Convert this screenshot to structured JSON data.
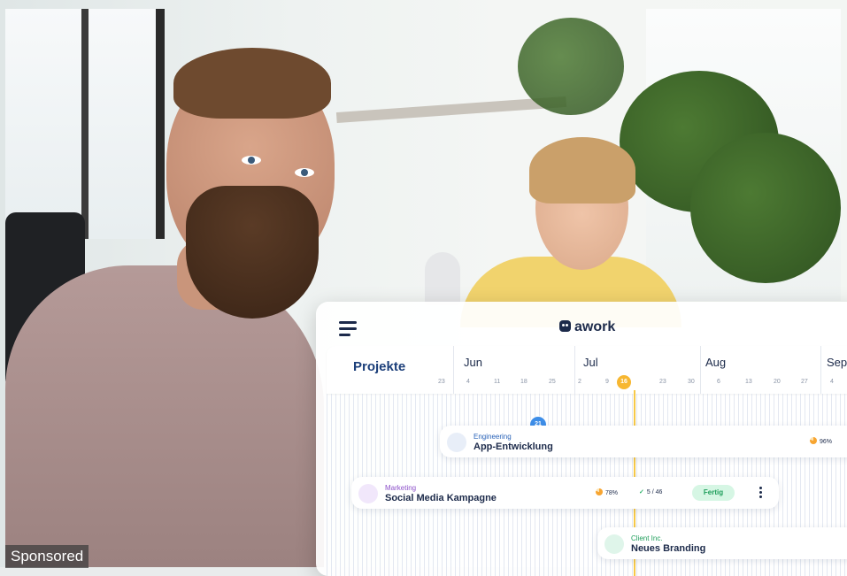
{
  "ad": {
    "label": "Sponsored"
  },
  "app": {
    "brand": "awork",
    "header_label": "Projekte",
    "timeline": {
      "first_week": "23",
      "months": [
        "Jun",
        "Jul",
        "Aug",
        "Sep"
      ],
      "days": [
        "4",
        "11",
        "18",
        "25",
        "2",
        "9",
        "16",
        "23",
        "30",
        "6",
        "13",
        "20",
        "27",
        "4"
      ],
      "today": "16"
    },
    "projects": [
      {
        "category": "Engineering",
        "name": "App-Entwicklung",
        "progress": "96%",
        "badge": "21",
        "icon": "folder-icon"
      },
      {
        "category": "Marketing",
        "name": "Social Media Kampagne",
        "progress": "78%",
        "tasks": "5 / 46",
        "status": "Fertig",
        "icon": "bookmark-icon"
      },
      {
        "category": "Client Inc.",
        "name": "Neues Branding",
        "icon": "person-icon"
      }
    ]
  },
  "colors": {
    "navy": "#1c2a4a",
    "accent_yellow": "#f7b731",
    "status_green": "#1f9e5b",
    "badge_blue": "#3e8ee8"
  }
}
